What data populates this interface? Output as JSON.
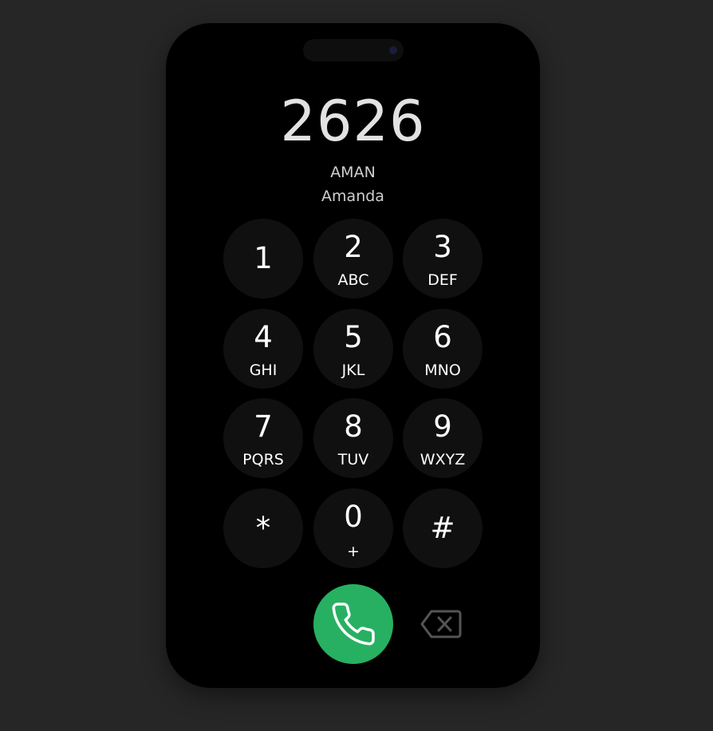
{
  "dialer": {
    "number": "2626",
    "contact_tag": "AMAN",
    "contact_name": "Amanda"
  },
  "keypad": [
    {
      "digit": "1",
      "letters": ""
    },
    {
      "digit": "2",
      "letters": "ABC"
    },
    {
      "digit": "3",
      "letters": "DEF"
    },
    {
      "digit": "4",
      "letters": "GHI"
    },
    {
      "digit": "5",
      "letters": "JKL"
    },
    {
      "digit": "6",
      "letters": "MNO"
    },
    {
      "digit": "7",
      "letters": "PQRS"
    },
    {
      "digit": "8",
      "letters": "TUV"
    },
    {
      "digit": "9",
      "letters": "WXYZ"
    },
    {
      "digit": "*",
      "letters": ""
    },
    {
      "digit": "0",
      "letters": "+"
    },
    {
      "digit": "#",
      "letters": ""
    }
  ],
  "actions": {
    "call_icon": "phone-icon",
    "delete_icon": "backspace-icon"
  },
  "colors": {
    "background": "#262626",
    "phone": "#000000",
    "key": "#101010",
    "call": "#27b062"
  }
}
